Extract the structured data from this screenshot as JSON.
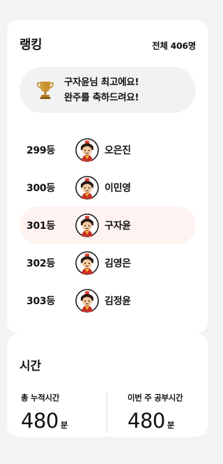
{
  "ranking": {
    "title": "랭킹",
    "total": "전체 406명",
    "congrats_line1": "구자윤님 최고에요!",
    "congrats_line2": "완주를 축하드려요!",
    "trophy_icon": "trophy-icon",
    "highlight_color": "#fff3f1",
    "rows": [
      {
        "rank": "299등",
        "name": "오은진",
        "avatar": "character-avatar-icon"
      },
      {
        "rank": "300등",
        "name": "이민영",
        "avatar": "character-avatar-icon"
      },
      {
        "rank": "301등",
        "name": "구자윤",
        "avatar": "character-avatar-icon",
        "current_user": true
      },
      {
        "rank": "302등",
        "name": "김영은",
        "avatar": "character-avatar-icon"
      },
      {
        "rank": "303등",
        "name": "김정윤",
        "avatar": "character-avatar-icon"
      }
    ]
  },
  "time": {
    "title": "시간",
    "total_label": "총 누적시간",
    "total_value": "480",
    "total_unit": "분",
    "week_label": "이번 주 공부시간",
    "week_value": "480",
    "week_unit": "분"
  }
}
